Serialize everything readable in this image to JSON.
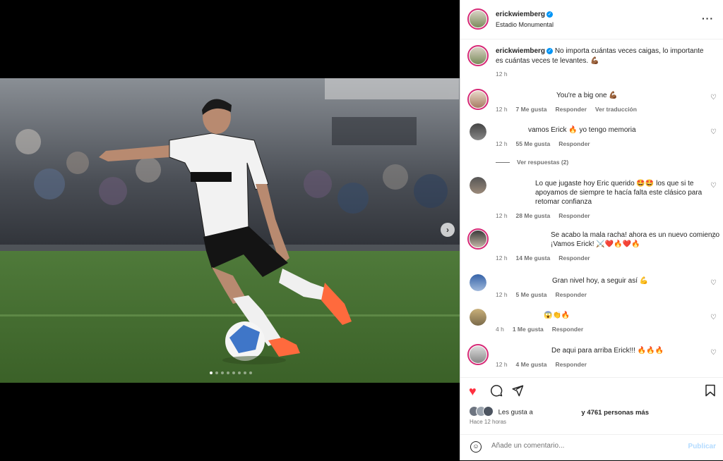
{
  "post": {
    "username": "erickwiemberg",
    "location": "Estadio Monumental",
    "caption_text": "No importa cuántas veces caigas, lo importante es cuántas veces te levantes. 💪🏾",
    "caption_time": "12 h"
  },
  "comments": [
    {
      "text": "You're a big one 💪🏾",
      "time": "12 h",
      "likes": "7 Me gusta",
      "reply": "Responder",
      "translate": "Ver traducción"
    },
    {
      "text": "vamos Erick 🔥 yo tengo memoria",
      "time": "12 h",
      "likes": "55 Me gusta",
      "reply": "Responder",
      "view_replies": "Ver respuestas (2)"
    },
    {
      "text": "Lo que jugaste hoy Eric querido 🤩🤩 los que si te apoyamos de siempre te hacía falta este clásico para retomar confianza",
      "time": "12 h",
      "likes": "28 Me gusta",
      "reply": "Responder"
    },
    {
      "text": "Se acabo la mala racha! ahora es un nuevo comienzo ¡Vamos Erick! ⚔️❤️🔥❤️🔥",
      "time": "12 h",
      "likes": "14 Me gusta",
      "reply": "Responder"
    },
    {
      "text": "Gran nivel hoy, a seguir así 💪",
      "time": "12 h",
      "likes": "5 Me gusta",
      "reply": "Responder"
    },
    {
      "text": "😱👏🔥",
      "time": "4 h",
      "likes": "1 Me gusta",
      "reply": "Responder"
    },
    {
      "text": "De aqui para arriba Erick!!! 🔥🔥🔥",
      "time": "12 h",
      "likes": "4 Me gusta",
      "reply": "Responder"
    }
  ],
  "likes_bar": {
    "prefix": "Les gusta a",
    "suffix": "y 4761 personas más",
    "time": "Hace 12 horas"
  },
  "composer": {
    "placeholder": "Añade un comentario...",
    "publish": "Publicar"
  },
  "carousel": {
    "slides": 8,
    "active": 1
  },
  "icons": {
    "more": "more-horizontal-icon",
    "like": "heart-filled-icon",
    "comment": "comment-icon",
    "share": "send-icon",
    "save": "bookmark-icon",
    "emoji": "emoji-icon",
    "next": "chevron-right-icon"
  },
  "colors": {
    "like_red": "#ff3040",
    "verified_blue": "#0095f6",
    "publish_disabled": "#b3dbff"
  }
}
